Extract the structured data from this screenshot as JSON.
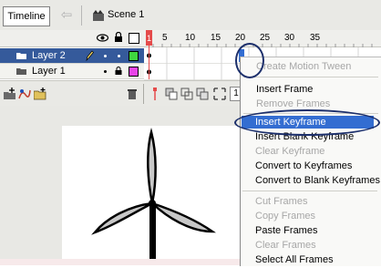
{
  "top_bar": {
    "timeline_label": "Timeline",
    "scene_label": "Scene 1"
  },
  "layers": [
    {
      "name": "Layer 2",
      "selected": true,
      "color": "#3fd63f"
    },
    {
      "name": "Layer 1",
      "selected": false,
      "color": "#e844e8"
    }
  ],
  "frame_ruler": {
    "ticks": [
      "1",
      "5",
      "10",
      "15",
      "20",
      "25",
      "30",
      "35"
    ]
  },
  "timeline_bottom": {
    "current_frame": "1"
  },
  "context_menu": {
    "items": [
      {
        "label": "Create Motion Tween",
        "disabled": true
      },
      {
        "label": "Insert Frame",
        "disabled": false
      },
      {
        "label": "Remove Frames",
        "disabled": true
      },
      {
        "label": "Insert Keyframe",
        "disabled": false,
        "highlighted": true
      },
      {
        "label": "Insert Blank Keyframe",
        "disabled": false
      },
      {
        "label": "Clear Keyframe",
        "disabled": true
      },
      {
        "label": "Convert to Keyframes",
        "disabled": false
      },
      {
        "label": "Convert to Blank Keyframes",
        "disabled": false
      },
      {
        "label": "Cut Frames",
        "disabled": true
      },
      {
        "label": "Copy Frames",
        "disabled": true
      },
      {
        "label": "Paste Frames",
        "disabled": false
      },
      {
        "label": "Clear Frames",
        "disabled": true
      },
      {
        "label": "Select All Frames",
        "disabled": false
      }
    ]
  },
  "colors": {
    "selection_blue": "#336dd1",
    "layer_selected_bg": "#355a9b",
    "playhead_red": "#e54b4b"
  },
  "icons": [
    "back-arrow-icon",
    "scene-icon",
    "eye-icon",
    "lock-icon",
    "outline-icon",
    "pencil-icon",
    "layer-icon",
    "add-layer-icon",
    "add-motion-guide-icon",
    "insert-folder-icon",
    "trash-icon",
    "center-frame-icon",
    "onion-skin-icon",
    "edit-multiple-frames-icon"
  ]
}
